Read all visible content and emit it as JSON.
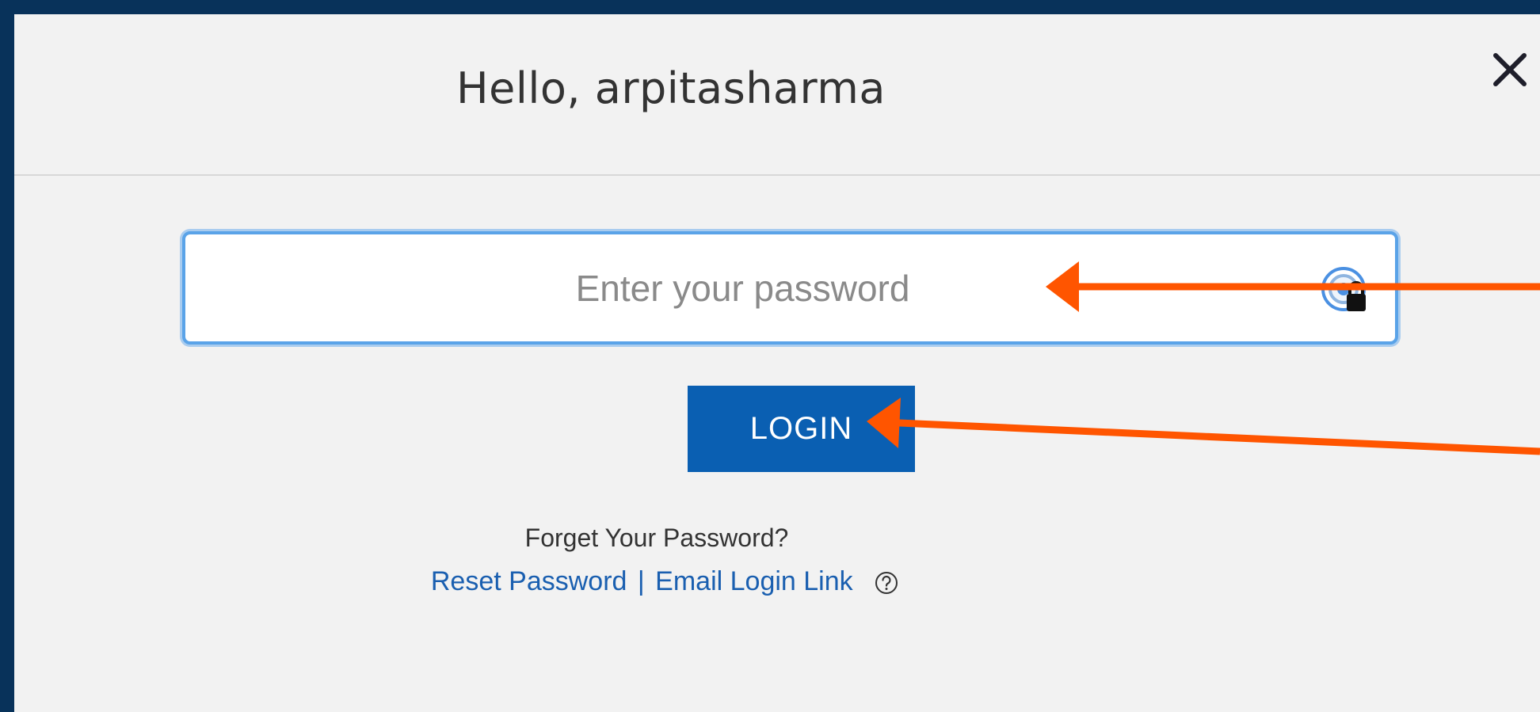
{
  "dialog": {
    "title": "Hello, arpitasharma",
    "close_icon": "close-icon"
  },
  "password": {
    "value": "",
    "placeholder": "Enter your password",
    "manager_icon": "password-manager-icon"
  },
  "login": {
    "label": "LOGIN"
  },
  "help_section": {
    "forgot_text": "Forget Your Password?",
    "reset_link": "Reset Password",
    "separator": "|",
    "email_link": "Email Login Link",
    "help_icon": "question-circle-icon"
  },
  "colors": {
    "backdrop": "#08325a",
    "dialog_bg": "#f2f2f2",
    "primary": "#0a5fb2",
    "link": "#1a5fb0",
    "input_focus": "#5aa3e8",
    "annotation_arrow": "#ff5500"
  }
}
